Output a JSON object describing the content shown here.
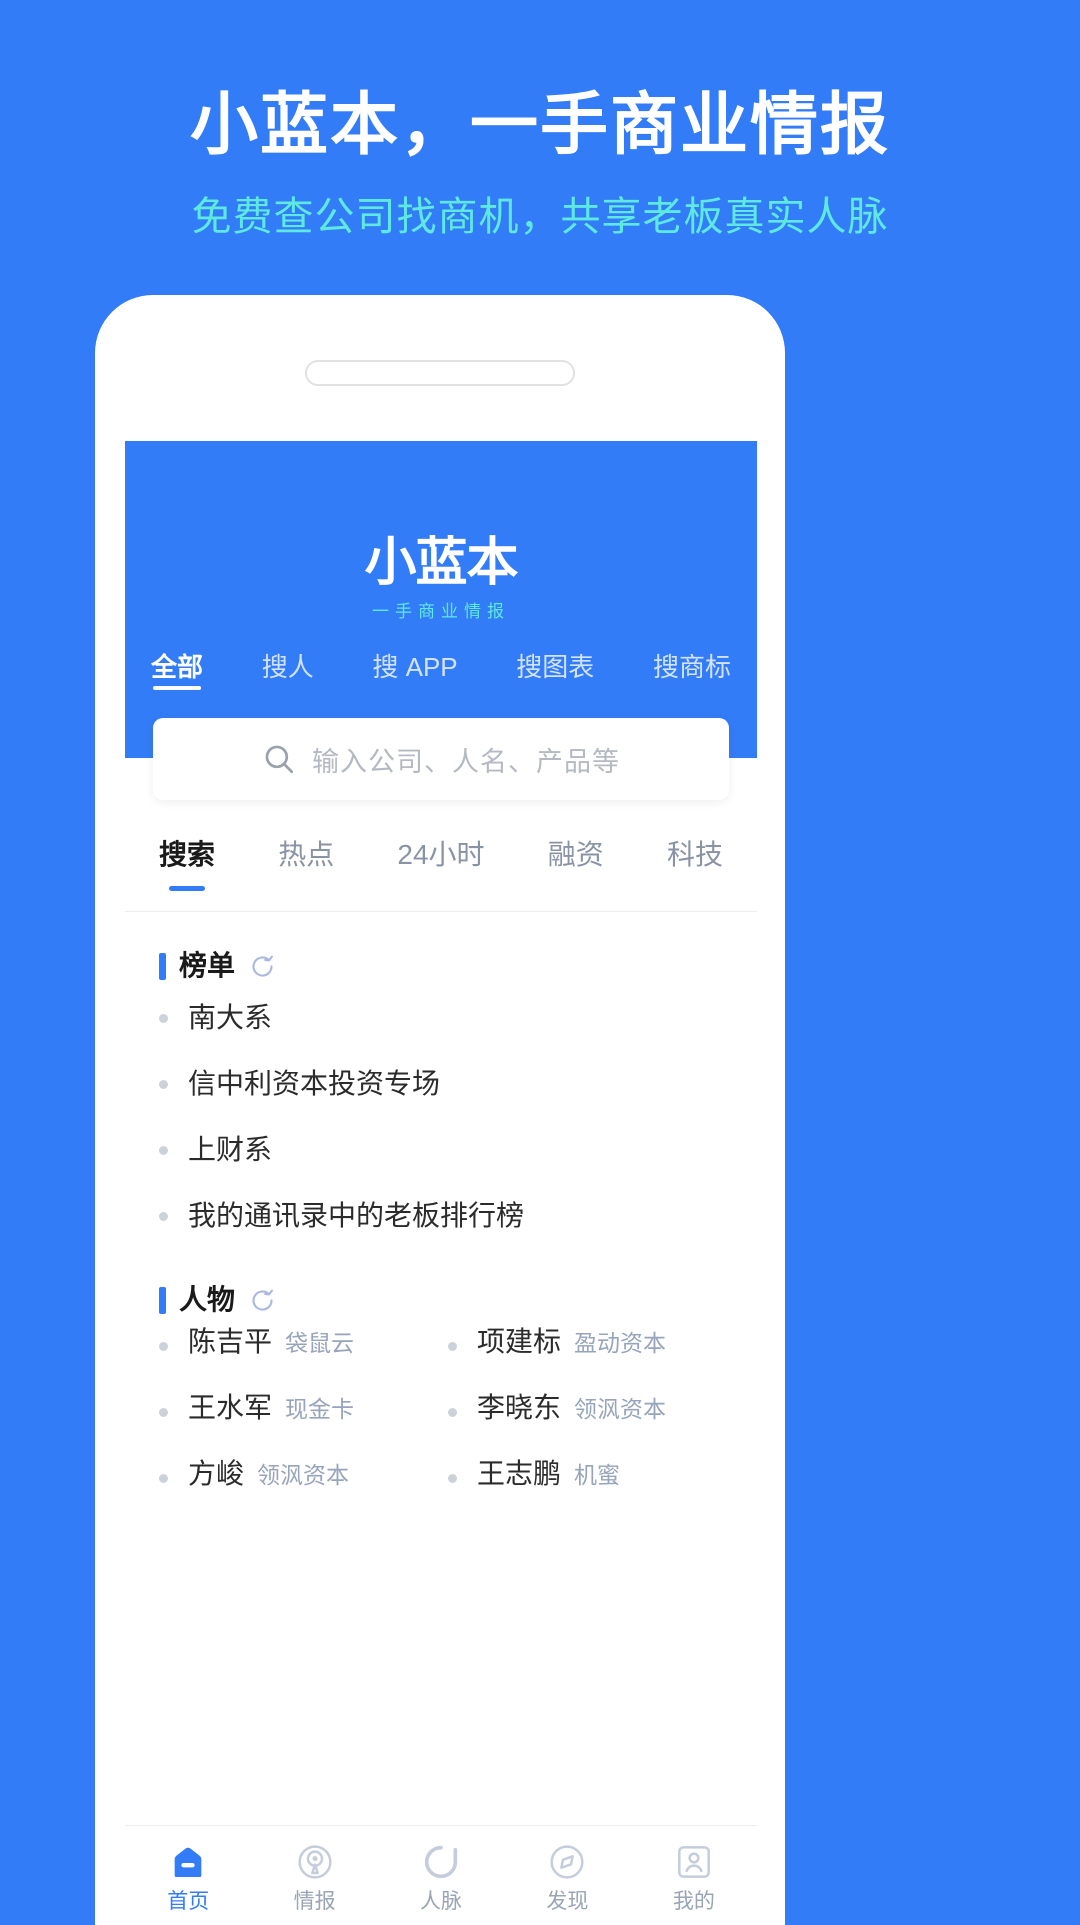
{
  "promo": {
    "title": "小蓝本，一手商业情报",
    "subtitle": "免费查公司找商机，共享老板真实人脉",
    "title_color": "#ffffff",
    "subtitle_color": "#5ee9e0",
    "background_color": "#337cf7"
  },
  "app": {
    "logo": "小蓝本",
    "logo_tagline": "一手商业情报",
    "brand_color": "#337cf7",
    "accent_color": "#5ee9e0",
    "category_tabs": [
      {
        "label": "全部",
        "active": true
      },
      {
        "label": "搜人",
        "active": false
      },
      {
        "label": "搜 APP",
        "active": false
      },
      {
        "label": "搜图表",
        "active": false
      },
      {
        "label": "搜商标",
        "active": false
      }
    ],
    "search": {
      "placeholder": "输入公司、人名、产品等",
      "icon": "search-icon"
    },
    "content_tabs": [
      {
        "label": "搜索",
        "active": true
      },
      {
        "label": "热点",
        "active": false
      },
      {
        "label": "24小时",
        "active": false
      },
      {
        "label": "融资",
        "active": false
      },
      {
        "label": "科技",
        "active": false
      }
    ],
    "sections": [
      {
        "title": "榜单",
        "refresh_icon": "refresh-icon",
        "items": [
          {
            "name": "南大系"
          },
          {
            "name": "信中利资本投资专场"
          },
          {
            "name": "上财系"
          },
          {
            "name": "我的通讯录中的老板排行榜"
          }
        ]
      },
      {
        "title": "人物",
        "refresh_icon": "refresh-icon",
        "people": [
          {
            "name": "陈吉平",
            "company": "袋鼠云"
          },
          {
            "name": "项建标",
            "company": "盈动资本"
          },
          {
            "name": "王水军",
            "company": "现金卡"
          },
          {
            "name": "李晓东",
            "company": "领沨资本"
          },
          {
            "name": "方峻",
            "company": "领沨资本"
          },
          {
            "name": "王志鹏",
            "company": "机蜜"
          }
        ]
      }
    ],
    "bottom_nav": [
      {
        "label": "首页",
        "icon": "home-icon",
        "active": true
      },
      {
        "label": "情报",
        "icon": "radar-icon",
        "active": false
      },
      {
        "label": "人脉",
        "icon": "network-icon",
        "active": false
      },
      {
        "label": "发现",
        "icon": "compass-icon",
        "active": false
      },
      {
        "label": "我的",
        "icon": "profile-icon",
        "active": false
      }
    ]
  }
}
